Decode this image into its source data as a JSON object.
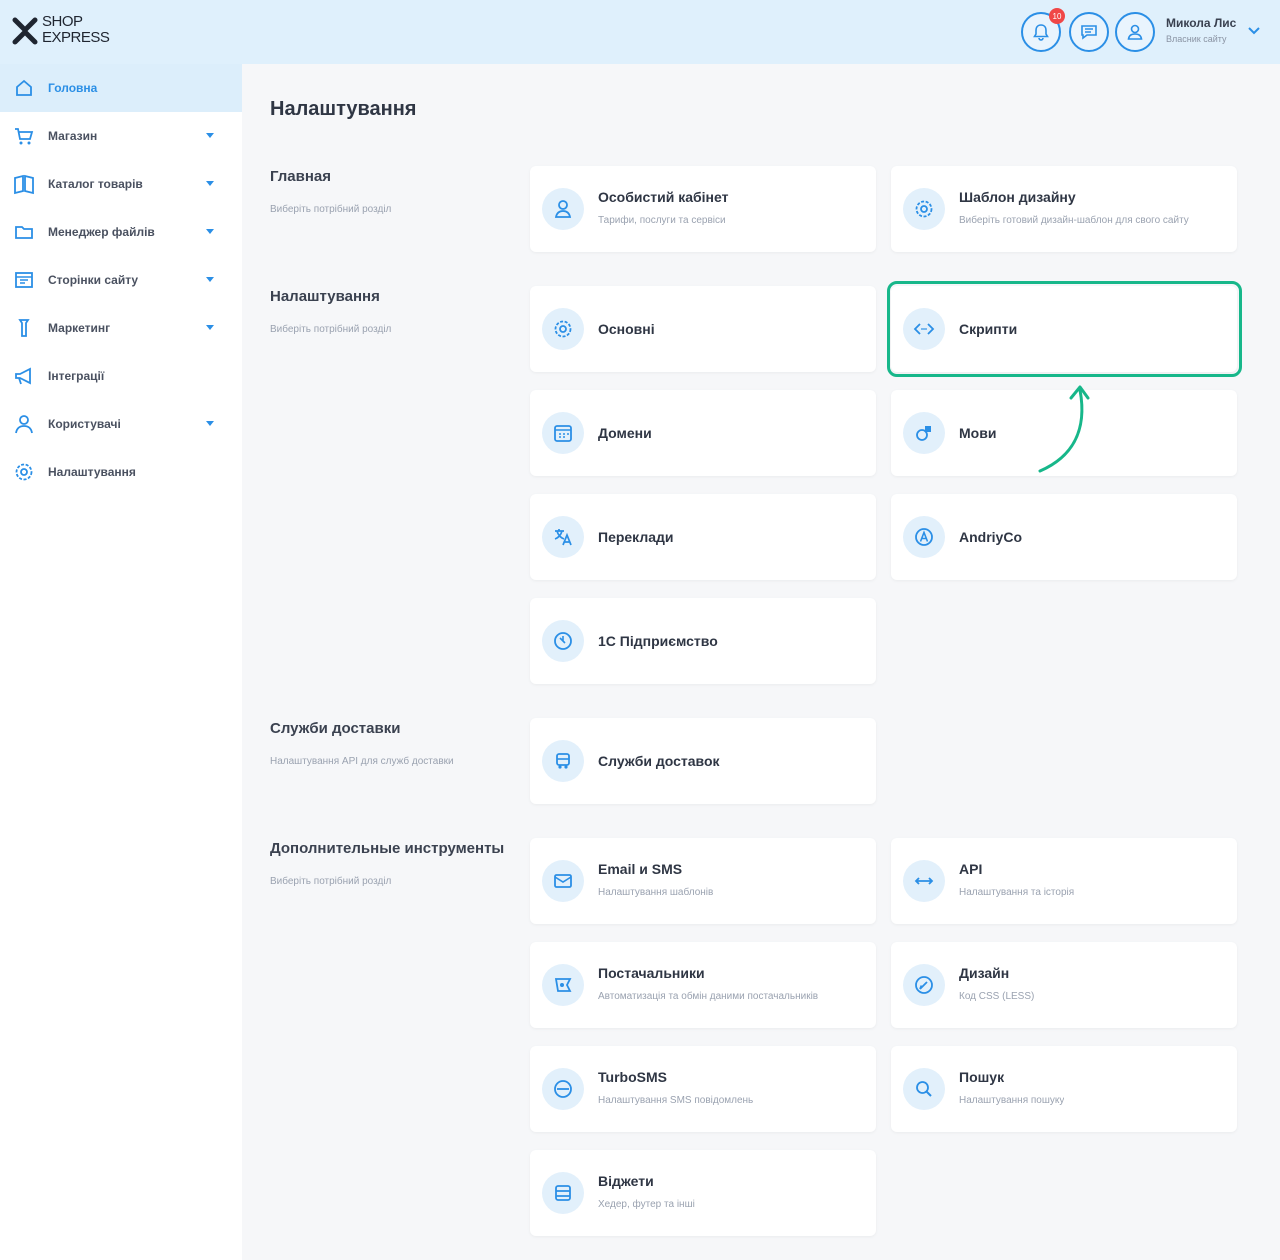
{
  "brand": {
    "line1": "SHOP",
    "line2": "EXPRESS"
  },
  "header": {
    "notifications_badge": "10",
    "user_name": "Микола Лис",
    "user_sub": "Власник сайту"
  },
  "sidebar": {
    "items": [
      {
        "label": "Головна",
        "icon": "home-icon"
      },
      {
        "label": "Магазин",
        "icon": "cart-icon"
      },
      {
        "label": "Каталог товарів",
        "icon": "book-icon"
      },
      {
        "label": "Менеджер файлів",
        "icon": "folder-icon"
      },
      {
        "label": "Сторінки сайту",
        "icon": "pages-icon"
      },
      {
        "label": "Маркетинг",
        "icon": "marketing-icon"
      },
      {
        "label": "Інтеграції",
        "icon": "megaphone-icon"
      },
      {
        "label": "Користувачі",
        "icon": "user-icon"
      },
      {
        "label": "Налаштування",
        "icon": "gear-icon"
      }
    ]
  },
  "page": {
    "title": "Налаштування"
  },
  "sections": [
    {
      "title": "Главная",
      "sub": "Виберіть потрібний розділ"
    },
    {
      "title": "Налаштування",
      "sub": "Виберіть потрібний розділ"
    },
    {
      "title": "Служби доставки",
      "sub": "Налаштування API для служб доставки"
    },
    {
      "title": "Дополнительные инструменты",
      "sub": "Виберіть потрібний розділ"
    }
  ],
  "cards": {
    "account": {
      "title": "Особистий кабінет",
      "sub": "Тарифи, послуги та сервіси",
      "icon": "user-icon"
    },
    "template": {
      "title": "Шаблон дизайну",
      "sub": "Виберіть готовий дизайн-шаблон для свого сайту",
      "icon": "gear-icon"
    },
    "basic": {
      "title": "Основні",
      "icon": "gear-icon"
    },
    "scripts": {
      "title": "Скрипти",
      "icon": "code-icon"
    },
    "domains": {
      "title": "Домени",
      "icon": "calendar-icon"
    },
    "languages": {
      "title": "Мови",
      "icon": "language-icon"
    },
    "translations": {
      "title": "Переклади",
      "icon": "translate-icon"
    },
    "andriyco": {
      "title": "AndriyCo",
      "icon": "a-circle-icon"
    },
    "onec": {
      "title": "1С Підприємство",
      "icon": "clock-icon"
    },
    "delivery": {
      "title": "Служби доставок",
      "icon": "truck-icon"
    },
    "email": {
      "title": "Email и SMS",
      "sub": "Налаштування шаблонів",
      "icon": "mail-icon"
    },
    "api": {
      "title": "API",
      "sub": "Налаштування та історія",
      "icon": "arrows-icon"
    },
    "suppliers": {
      "title": "Постачальники",
      "sub": "Автоматизація та обмін даними постачальників",
      "icon": "supplier-icon"
    },
    "design": {
      "title": "Дизайн",
      "sub": "Код CSS (LESS)",
      "icon": "pen-icon"
    },
    "turbosms": {
      "title": "TurboSMS",
      "sub": "Налаштування SMS повідомлень",
      "icon": "sms-icon"
    },
    "search": {
      "title": "Пошук",
      "sub": "Налаштування пошуку",
      "icon": "search-icon"
    },
    "widgets": {
      "title": "Віджети",
      "sub": "Хедер, футер та інші",
      "icon": "widget-icon"
    }
  },
  "colors": {
    "accent": "#2b8fe6",
    "highlight": "#17b78a",
    "header_bg": "#dff0fc",
    "active_bg": "#dceefb"
  }
}
